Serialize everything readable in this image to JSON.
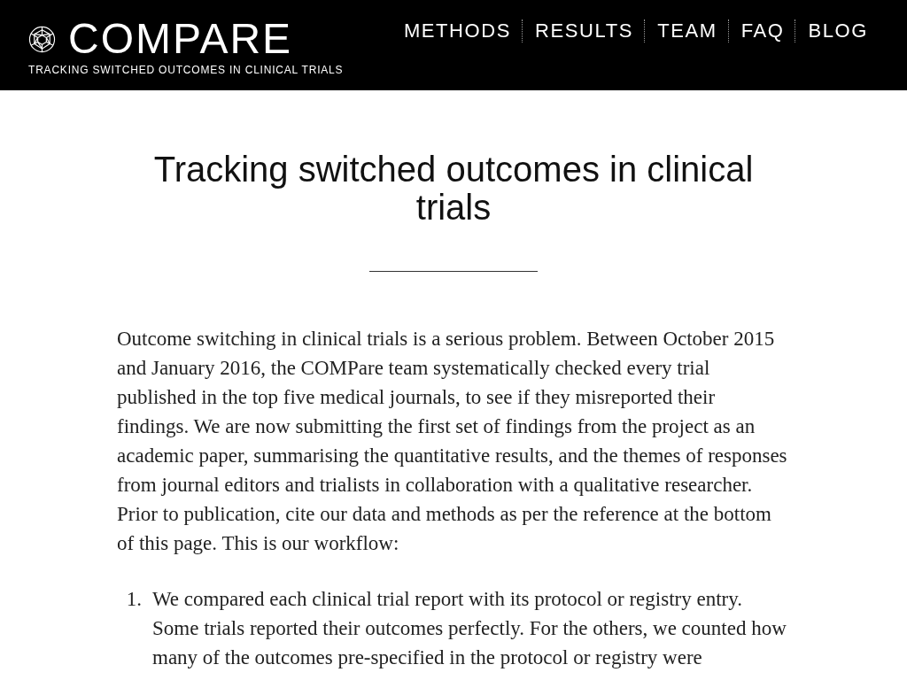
{
  "header": {
    "logo": {
      "title": "COMPARE",
      "tagline": "TRACKING SWITCHED OUTCOMES IN CLINICAL TRIALS"
    },
    "nav": [
      {
        "label": "METHODS"
      },
      {
        "label": "RESULTS"
      },
      {
        "label": "TEAM"
      },
      {
        "label": "FAQ"
      },
      {
        "label": "BLOG"
      }
    ]
  },
  "main": {
    "title": "Tracking switched outcomes in clinical trials",
    "intro": "Outcome switching in clinical trials is a serious problem. Between October 2015 and January 2016, the COMPare team systematically checked every trial published in the top five medical journals, to see if they misreported their findings. We are now submitting the first set of findings from the project as an academic paper, summarising the quantitative results, and the themes of responses from journal editors and trialists in collaboration with a qualitative researcher. Prior to publication, cite our data and methods as per the reference at the bottom of this page. This is our workflow:",
    "steps": [
      {
        "number": "1.",
        "text": "We compared each clinical trial report with its protocol or registry entry. Some trials reported their outcomes perfectly. For the others, we counted how many of the outcomes pre-specified in the protocol or registry were"
      }
    ]
  }
}
